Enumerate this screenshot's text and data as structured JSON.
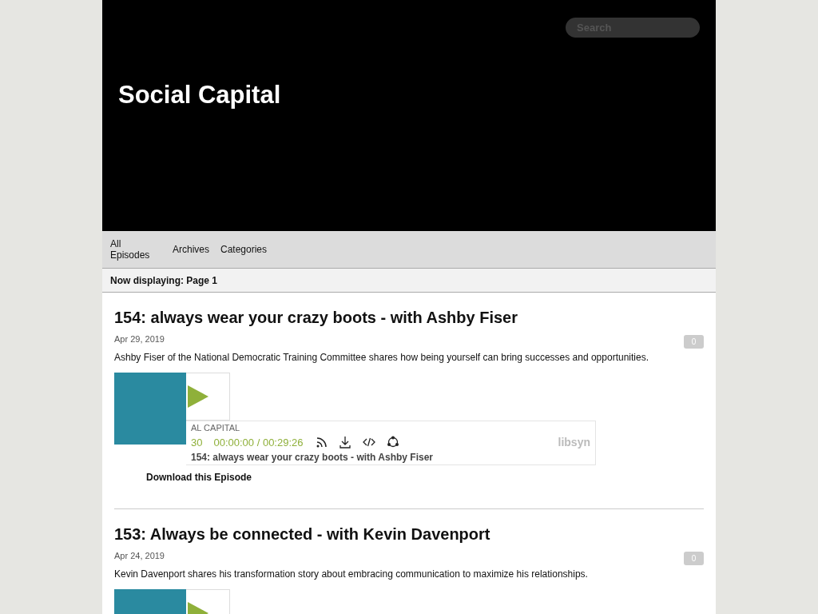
{
  "header": {
    "title": "Social Capital",
    "search": {
      "placeholder": "Search"
    }
  },
  "nav": [
    "All Episodes",
    "Archives",
    "Categories"
  ],
  "page_status": "Now displaying: Page 1",
  "episodes": [
    {
      "title": "154: always wear your crazy boots - with Ashby Fiser",
      "date": "Apr 29, 2019",
      "comments": "0",
      "description": "Ashby Fiser of the National Democratic Training Committee shares how being yourself can bring successes and opportunities.",
      "player": {
        "show": "AL CAPITAL",
        "skip": "30",
        "time": "00:00:00 / 00:29:26",
        "title": "154: always wear your crazy boots - with Ashby Fiser",
        "brand": "libsyn"
      },
      "download": "Download this Episode"
    },
    {
      "title": "153: Always be connected - with Kevin Davenport",
      "date": "Apr 24, 2019",
      "comments": "0",
      "description": "Kevin Davenport shares his transformation story about embracing communication to maximize his relationships."
    }
  ]
}
